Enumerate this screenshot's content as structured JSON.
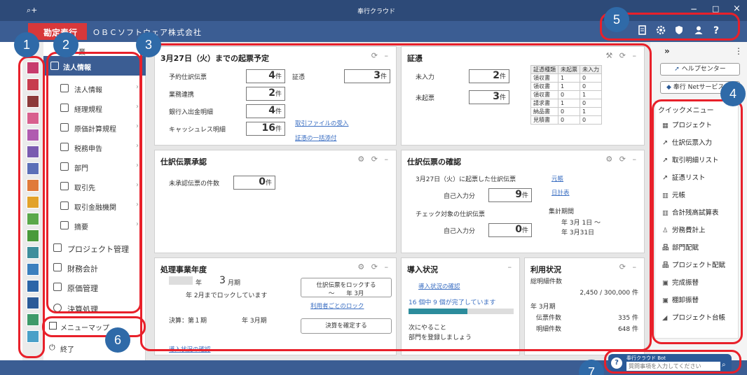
{
  "window": {
    "title": "奉行クラウド",
    "search_glyph": "⌕+",
    "controls": [
      "−",
      "□",
      "×"
    ]
  },
  "appbar": {
    "product": "勘定奉行",
    "company": "ＯＢＣソフトウェア株式会社",
    "icons": [
      "notes-icon",
      "gear-icon",
      "shield-icon",
      "user-icon",
      "help-icon"
    ],
    "help_glyph": "?"
  },
  "sidebar": {
    "header_fragment": "業",
    "items": [
      {
        "label": "法人情報",
        "active": true
      },
      {
        "label": "法人情報"
      },
      {
        "label": "経理規程"
      },
      {
        "label": "原価計算規程"
      },
      {
        "label": "税務申告"
      },
      {
        "label": "部門"
      },
      {
        "label": "取引先"
      },
      {
        "label": "取引金融機関"
      },
      {
        "label": "摘要"
      }
    ],
    "groups": [
      {
        "label": "プロジェクト管理"
      },
      {
        "label": "財務会計"
      },
      {
        "label": "原価管理"
      },
      {
        "label": "決算処理"
      }
    ],
    "menu_map": "メニューマップ",
    "exit": "終了"
  },
  "panels": {
    "kihyo": {
      "title": "3月27日（火）までの起票予定",
      "rows": [
        {
          "label": "予約仕訳伝票",
          "value": "4",
          "unit": "件"
        },
        {
          "label": "業務連携",
          "value": "2",
          "unit": "件"
        },
        {
          "label": "銀行入出金明細",
          "value": "4",
          "unit": "件"
        },
        {
          "label": "キャッシュレス明細",
          "value": "16",
          "unit": "件"
        }
      ],
      "shouhyo_label": "証憑",
      "shouhyo_value": "3",
      "shouhyo_unit": "件",
      "link1": "取引ファイルの受入",
      "link2": "証憑の一括添付"
    },
    "shouhyo": {
      "title": "証憑",
      "rows": [
        {
          "label": "未入力",
          "value": "2",
          "unit": "件"
        },
        {
          "label": "未起票",
          "value": "3",
          "unit": "件"
        }
      ],
      "table_headers": [
        "証憑種類",
        "未起票",
        "未入力"
      ],
      "table_rows": [
        [
          "領収書",
          "1",
          "0"
        ],
        [
          "領収書",
          "1",
          "0"
        ],
        [
          "領収書",
          "0",
          "1"
        ],
        [
          "請求書",
          "1",
          "0"
        ],
        [
          "納品書",
          "0",
          "1"
        ],
        [
          "見積書",
          "0",
          "0"
        ]
      ]
    },
    "shonin": {
      "title": "仕訳伝票承認",
      "label": "未承認伝票の件数",
      "value": "0",
      "unit": "件"
    },
    "kakunin": {
      "title": "仕訳伝票の確認",
      "line1": "3月27日（火）に起票した仕訳伝票",
      "self_label": "自己入力分",
      "v1": "9",
      "unit": "件",
      "line2": "チェック対象の仕訳伝票",
      "v2": "0",
      "link_a": "元帳",
      "link_b": "日計表",
      "period_label": "集計期間",
      "period1": "年 3月 1日 ～",
      "period2": "年 3月31日"
    },
    "nendo": {
      "title": "処理事業年度",
      "year_suffix": "年",
      "month": "3",
      "month_suffix": "月期",
      "lock_note": "年 2月までロックしています",
      "kessan_label": "決算：第１期",
      "kessan_to": "年 3月期",
      "btn_lock": "仕訳伝票をロックする",
      "btn_lock_sub": "～　　年 3月",
      "link_lock": "利用者ごとのロック",
      "btn_kessan": "決算を確定する",
      "footer_link": "導入状況の確認"
    },
    "dounyu": {
      "title": "導入状況",
      "link": "導入状況の確認",
      "progress_text": "16 個中 9 個が完了しています",
      "progress": 0.56,
      "next_label": "次にやること",
      "next_text": "部門を登録しましょう"
    },
    "riyou": {
      "title": "利用状況",
      "total_label": "総明細件数",
      "total_value": "2,450 / 300,000 件",
      "period": "年 3月期",
      "r1_label": "伝票件数",
      "r1_value": "335 件",
      "r2_label": "明細件数",
      "r2_value": "648 件"
    }
  },
  "right": {
    "expand_glyph": "»",
    "more_glyph": "⋮",
    "help_center": "ヘルプセンター",
    "net_service": "奉行 Netサービス",
    "quick_title": "クイックメニュー",
    "quick_items": [
      "プロジェクト",
      "仕訳伝票入力",
      "取引明細リスト",
      "証憑リスト",
      "元帳",
      "合計残高試算表",
      "労務費計上",
      "部門配賦",
      "プロジェクト配賦",
      "完成振替",
      "棚卸振替",
      "プロジェクト台帳"
    ]
  },
  "bot": {
    "label": "奉行クラウド Bot",
    "placeholder": "質問事項を入力してください"
  },
  "callouts": [
    "1",
    "2",
    "3",
    "4",
    "5",
    "6",
    "7"
  ],
  "colors": {
    "callout_fill": "#2f6aa8",
    "highlight_border": "#e8202a",
    "appbar": "#3b5d93",
    "titlebar": "#2d4a78"
  }
}
